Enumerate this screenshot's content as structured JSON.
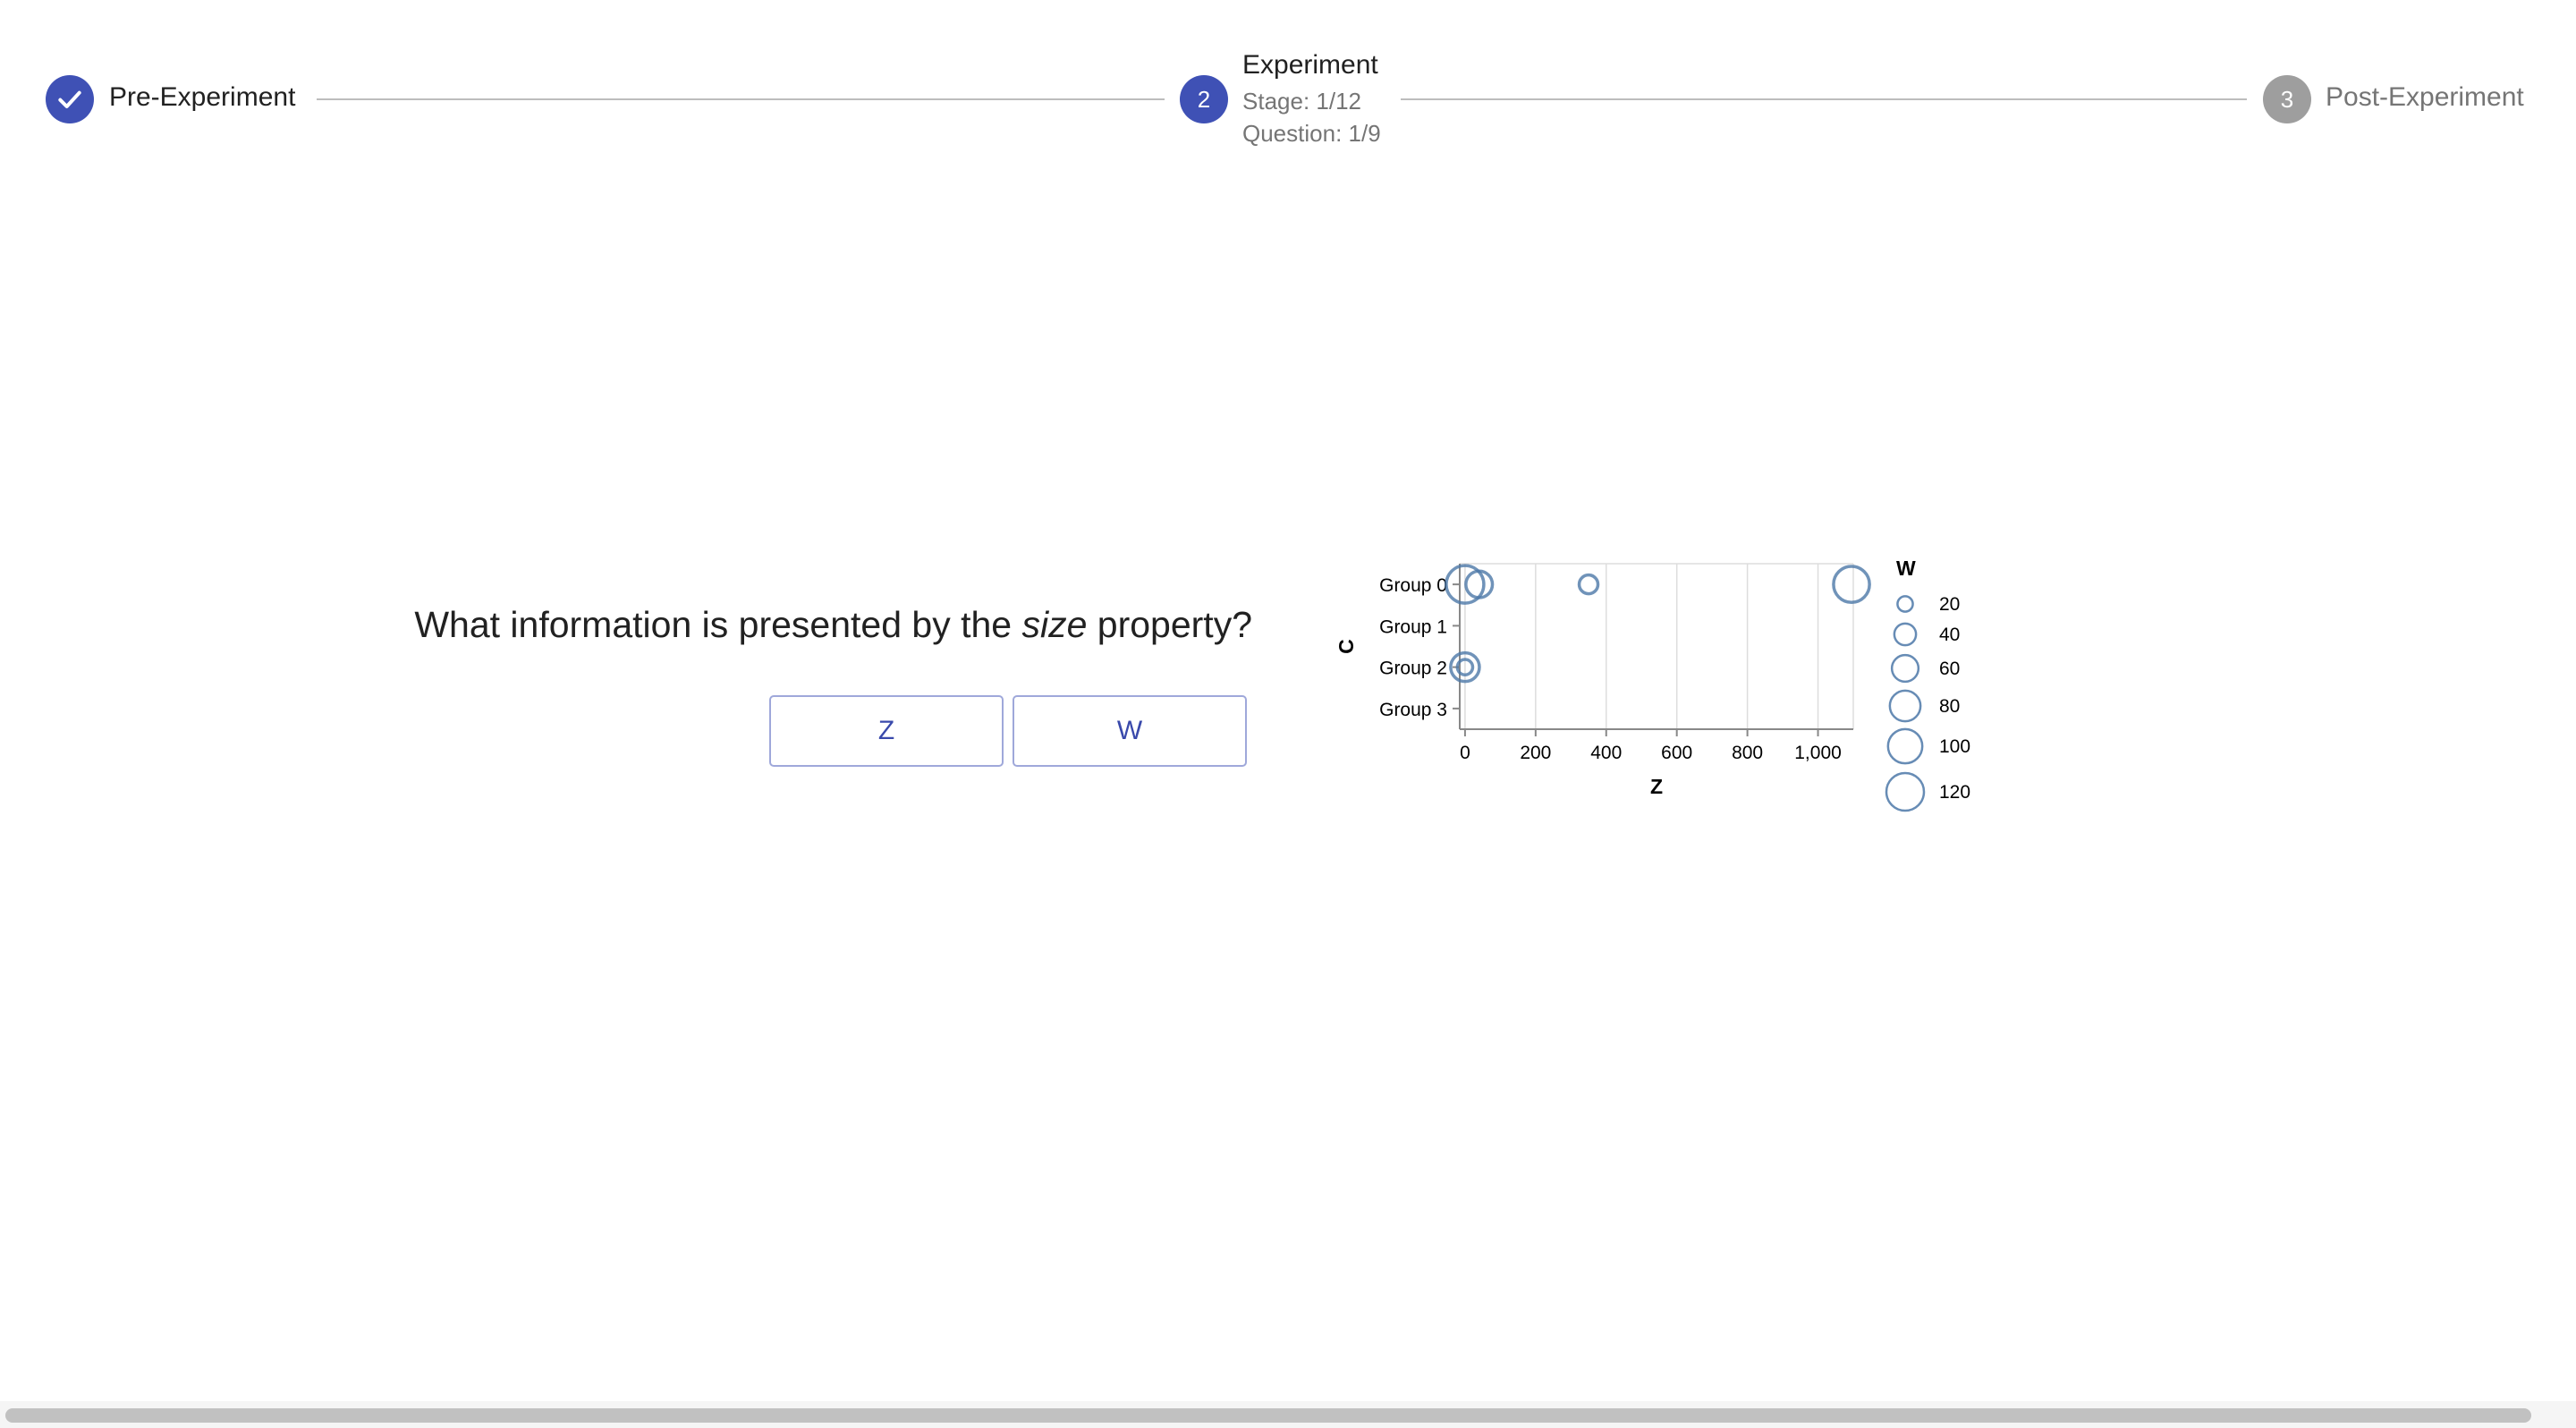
{
  "stepper": {
    "steps": [
      {
        "label": "Pre-Experiment",
        "state": "completed",
        "icon": "check-icon"
      },
      {
        "number": "2",
        "label": "Experiment",
        "state": "active",
        "stage": "Stage: 1/12",
        "question": "Question: 1/9"
      },
      {
        "number": "3",
        "label": "Post-Experiment",
        "state": "pending"
      }
    ],
    "colors": {
      "active": "#3f51b5",
      "pending": "#9e9e9e",
      "connector": "#bdbdbd"
    }
  },
  "question": {
    "prefix": "What information is presented by the ",
    "emphasis": "size",
    "suffix": " property?"
  },
  "answers": [
    {
      "label": "Z"
    },
    {
      "label": "W"
    }
  ],
  "chart_data": {
    "type": "scatter",
    "encoding": "bubble",
    "xlabel": "Z",
    "ylabel": "C",
    "x_ticks": [
      "0",
      "200",
      "400",
      "600",
      "800",
      "1,000"
    ],
    "x_tick_values": [
      0,
      200,
      400,
      600,
      800,
      1000
    ],
    "xlim": [
      -15,
      1100
    ],
    "categories": [
      "Group 0",
      "Group 1",
      "Group 2",
      "Group 3"
    ],
    "grid": true,
    "mark_color": "#4c78a8",
    "points": [
      {
        "category": "Group 0",
        "x": 0,
        "w": 120
      },
      {
        "category": "Group 0",
        "x": 40,
        "w": 60
      },
      {
        "category": "Group 0",
        "x": 350,
        "w": 30
      },
      {
        "category": "Group 0",
        "x": 1095,
        "w": 110
      },
      {
        "category": "Group 2",
        "x": 0,
        "w": 70
      },
      {
        "category": "Group 2",
        "x": 0,
        "w": 20
      }
    ],
    "legend": {
      "title": "W",
      "position": "right",
      "values": [
        20,
        40,
        60,
        80,
        100,
        120
      ],
      "labels": [
        "20",
        "40",
        "60",
        "80",
        "100",
        "120"
      ]
    }
  },
  "scrollbar": {
    "orientation": "horizontal"
  }
}
